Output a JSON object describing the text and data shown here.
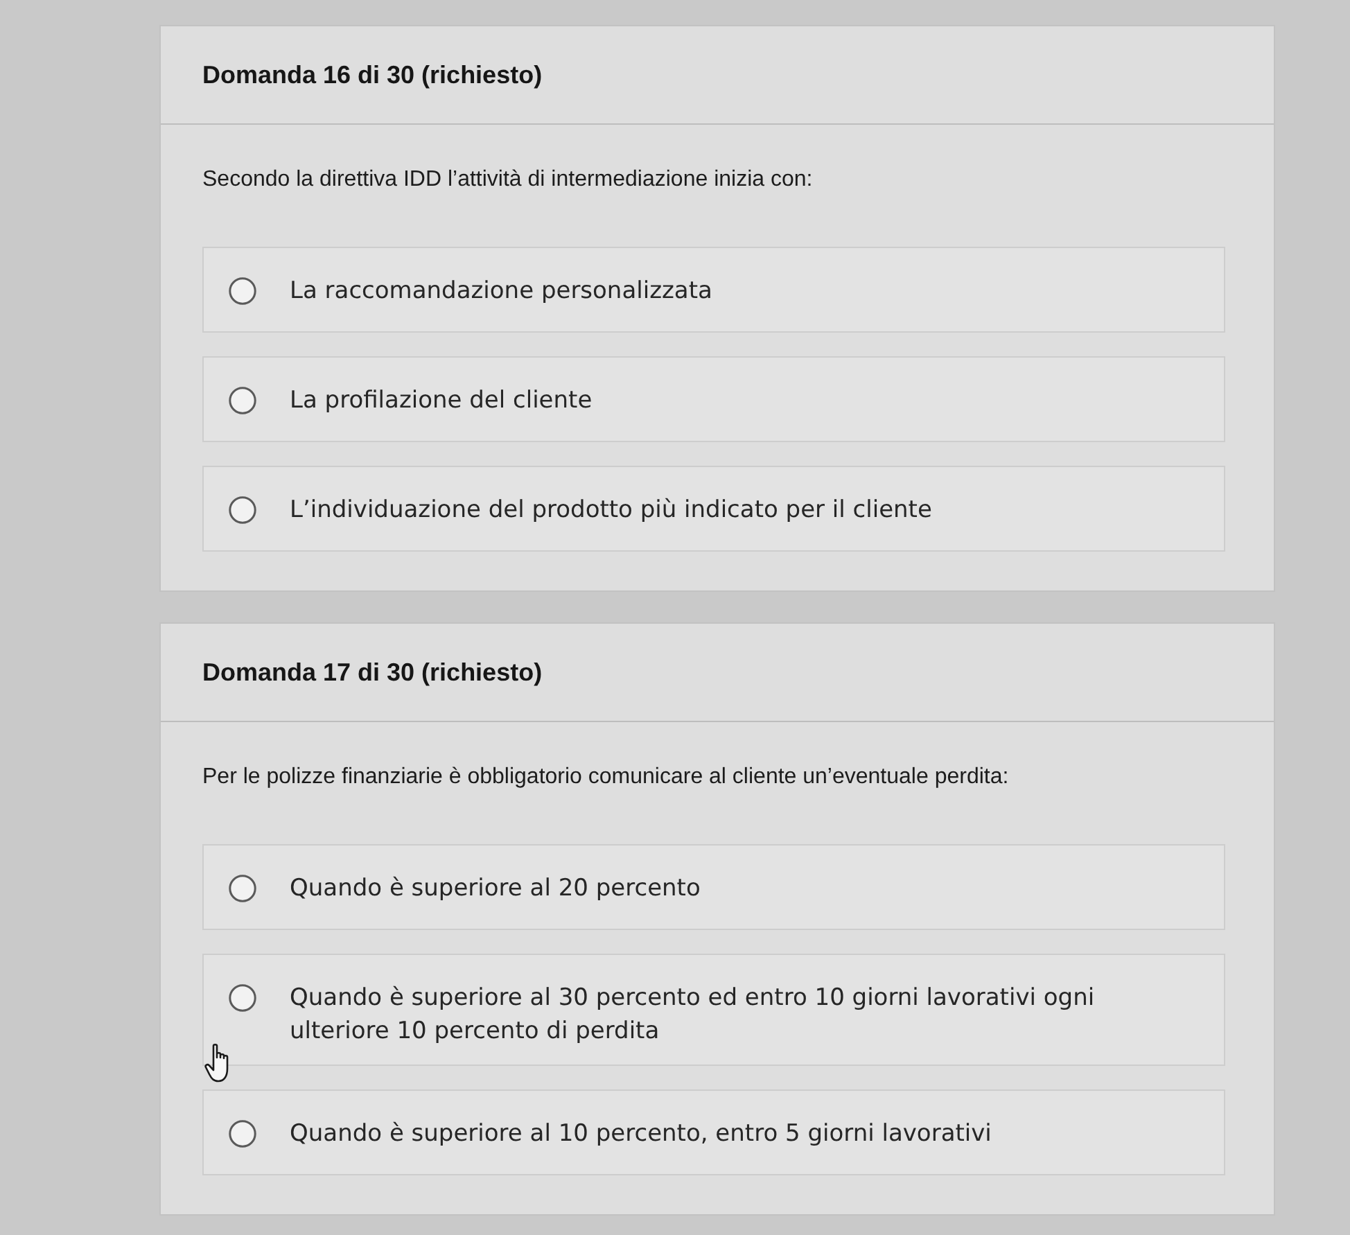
{
  "questions": [
    {
      "title": "Domanda 16 di 30 (richiesto)",
      "prompt": "Secondo la direttiva IDD l’attività di intermediazione inizia con:",
      "options": [
        {
          "label": "La raccomandazione personalizzata",
          "selected": false
        },
        {
          "label": "La profilazione del cliente",
          "selected": false
        },
        {
          "label": "L’individuazione del prodotto più indicato per il cliente",
          "selected": false
        }
      ]
    },
    {
      "title": "Domanda 17 di 30 (richiesto)",
      "prompt": "Per le polizze finanziarie è obbligatorio comunicare al cliente un’eventuale perdita:",
      "options": [
        {
          "label": "Quando è superiore al 20 percento",
          "selected": false
        },
        {
          "label": "Quando è superiore al 30 percento ed entro 10 giorni lavorativi ogni ulteriore 10 percento di perdita",
          "selected": false
        },
        {
          "label": "Quando è superiore al 10 percento, entro 5 giorni lavorativi",
          "selected": false
        }
      ]
    }
  ]
}
